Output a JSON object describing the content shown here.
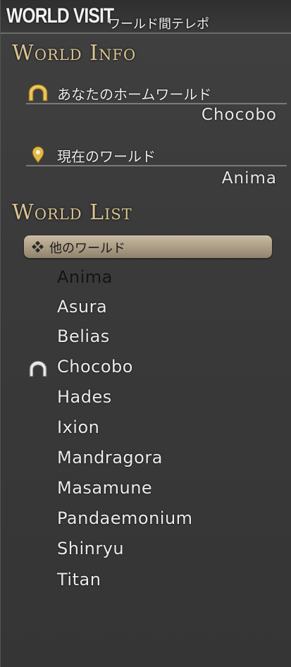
{
  "window": {
    "title": "WORLD VISIT",
    "subtitle": "ワールド間テレポ"
  },
  "world_info": {
    "heading": "World Info",
    "home_world_label": "あなたのホームワールド",
    "home_world_value": "Chocobo",
    "current_world_label": "現在のワールド",
    "current_world_value": "Anima"
  },
  "world_list": {
    "heading": "World List",
    "category_label": "他のワールド",
    "worlds": [
      {
        "name": "Anima"
      },
      {
        "name": "Asura"
      },
      {
        "name": "Belias"
      },
      {
        "name": "Chocobo"
      },
      {
        "name": "Hades"
      },
      {
        "name": "Ixion"
      },
      {
        "name": "Mandragora"
      },
      {
        "name": "Masamune"
      },
      {
        "name": "Pandaemonium"
      },
      {
        "name": "Shinryu"
      },
      {
        "name": "Titan"
      }
    ]
  },
  "icons": {
    "home": "home-arch-icon",
    "current_location": "map-pin-icon",
    "category": "diamond-cluster-icon"
  },
  "colors": {
    "heading_gold": "#d9c592",
    "icon_gold": "#e2b84a",
    "category_bar": "#b2a48c",
    "panel_background": "#3a3a3a"
  }
}
